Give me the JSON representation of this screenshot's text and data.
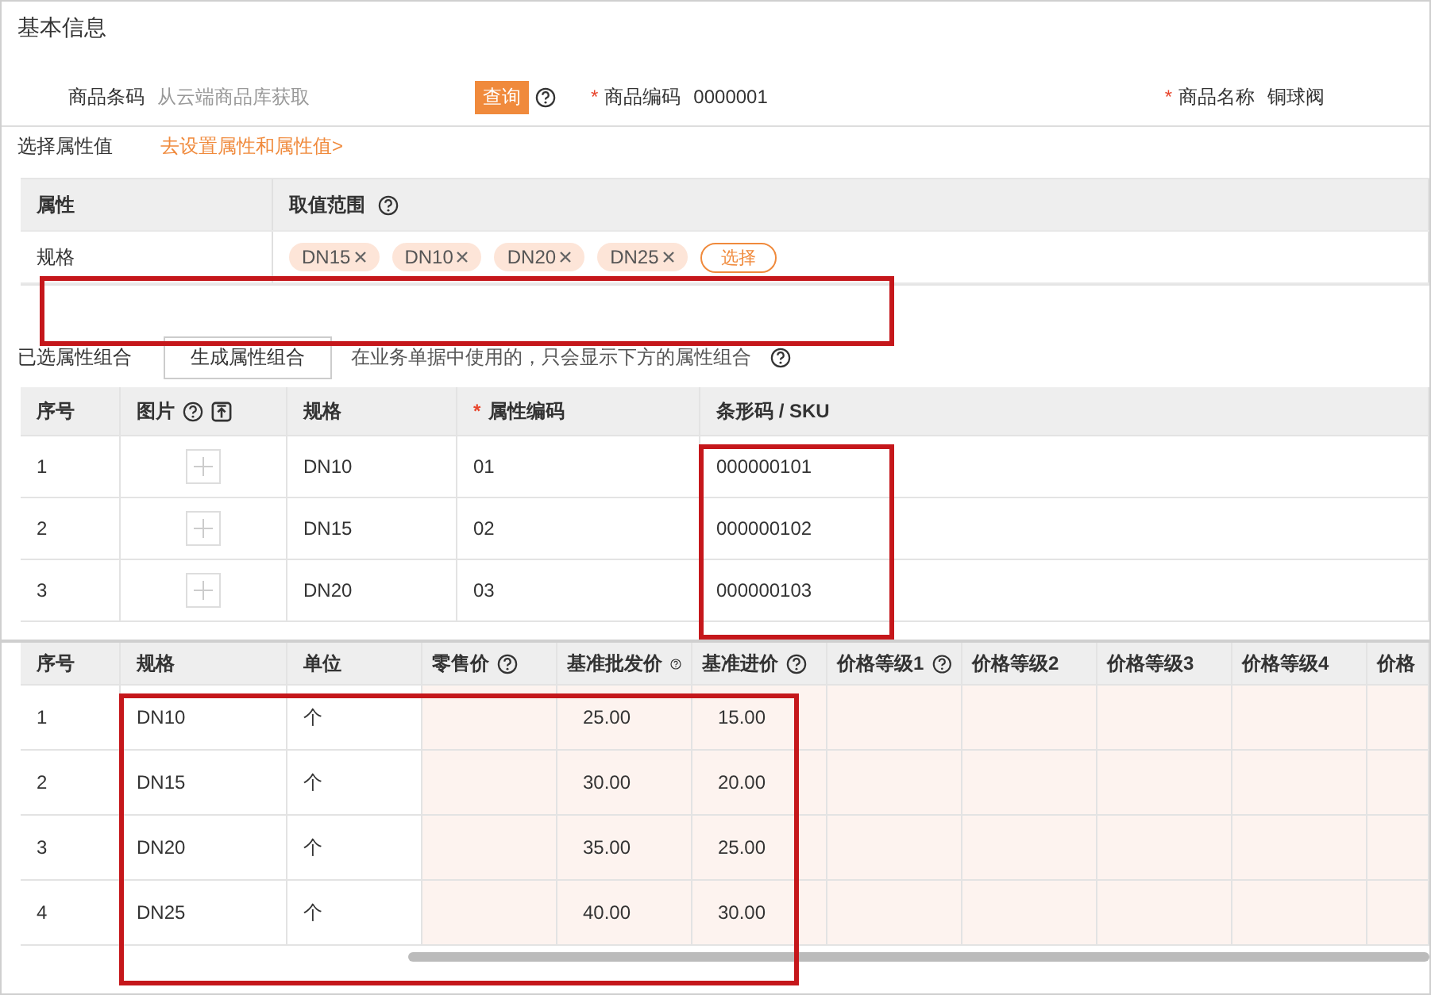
{
  "basic_info": {
    "title": "基本信息",
    "barcode": {
      "label": "商品条码",
      "placeholder": "从云端商品库获取",
      "button": "查询",
      "help": true
    },
    "code": {
      "required_mark": "*",
      "label": "商品编码",
      "value": "0000001"
    },
    "name": {
      "required_mark": "*",
      "label": "商品名称",
      "value": "铜球阀"
    }
  },
  "attribute_select": {
    "label": "选择属性值",
    "link": "去设置属性和属性值>",
    "columns": [
      {
        "label": "属性",
        "help": false
      },
      {
        "label": "取值范围",
        "help": true
      }
    ],
    "rows": [
      {
        "attribute": "规格",
        "tags": [
          "DN15",
          "DN10",
          "DN20",
          "DN25"
        ],
        "button": "选择"
      }
    ]
  },
  "combination": {
    "label": "已选属性组合",
    "button": "生成属性组合",
    "note": "在业务单据中使用的，只会显示下方的属性组合",
    "help": true
  },
  "combination_table": {
    "columns": [
      {
        "label": "序号",
        "help": false,
        "upload": false
      },
      {
        "label": "图片",
        "help": true,
        "upload": true
      },
      {
        "label": "规格",
        "help": false,
        "upload": false
      },
      {
        "required_mark": "*",
        "label": "属性编码",
        "help": false,
        "upload": false
      },
      {
        "label": "条形码 / SKU",
        "help": false,
        "upload": false
      }
    ],
    "rows": [
      {
        "no": "1",
        "spec": "DN10",
        "code": "01",
        "sku": "000000101"
      },
      {
        "no": "2",
        "spec": "DN15",
        "code": "02",
        "sku": "000000102"
      },
      {
        "no": "3",
        "spec": "DN20",
        "code": "03",
        "sku": "000000103"
      }
    ]
  },
  "price_table": {
    "columns": [
      {
        "label": "序号",
        "kind": "text",
        "help": false
      },
      {
        "label": "规格",
        "kind": "text",
        "help": false
      },
      {
        "label": "单位",
        "kind": "text",
        "help": false
      },
      {
        "label": "零售价",
        "kind": "price",
        "help": true
      },
      {
        "label": "基准批发价",
        "kind": "price",
        "help": true
      },
      {
        "label": "基准进价",
        "kind": "price",
        "help": true
      },
      {
        "label": "价格等级1",
        "kind": "price",
        "help": true
      },
      {
        "label": "价格等级2",
        "kind": "price",
        "help": false
      },
      {
        "label": "价格等级3",
        "kind": "price",
        "help": false
      },
      {
        "label": "价格等级4",
        "kind": "price",
        "help": false
      },
      {
        "label": "价格",
        "kind": "price"
      }
    ],
    "rows": [
      [
        "1",
        "DN10",
        "个",
        null,
        "25.00",
        "15.00",
        null,
        null,
        null,
        null,
        null
      ],
      [
        "2",
        "DN15",
        "个",
        null,
        "30.00",
        "20.00",
        null,
        null,
        null,
        null,
        null
      ],
      [
        "3",
        "DN20",
        "个",
        null,
        "35.00",
        "25.00",
        null,
        null,
        null,
        null,
        null
      ],
      [
        "4",
        "DN25",
        "个",
        null,
        "40.00",
        "30.00",
        null,
        null,
        null,
        null,
        null
      ]
    ]
  }
}
